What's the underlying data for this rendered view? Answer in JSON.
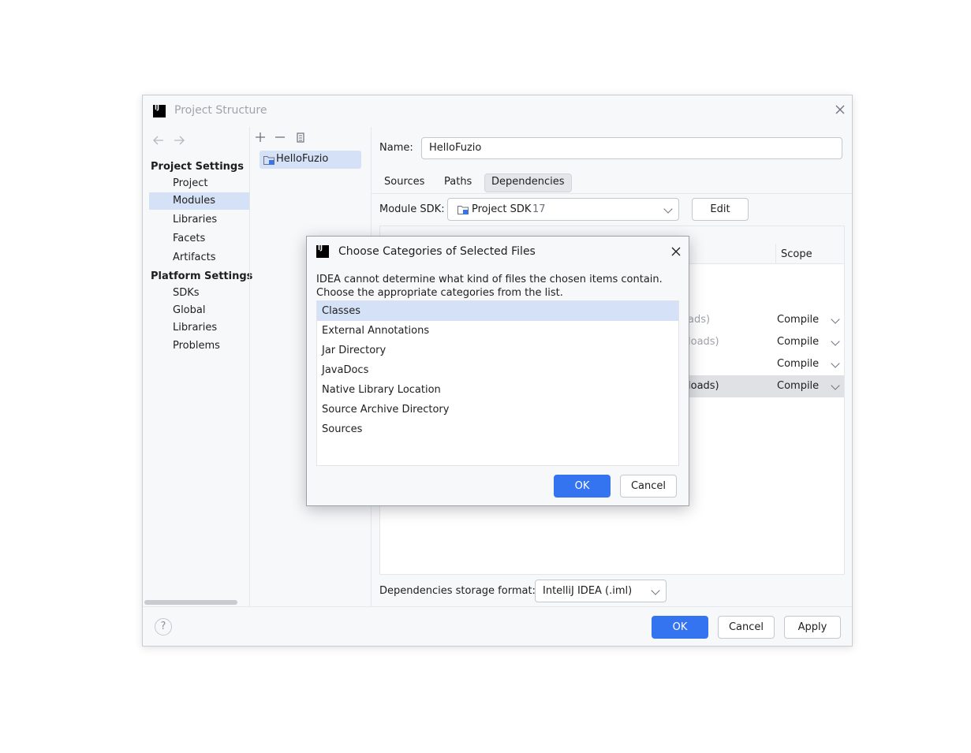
{
  "window": {
    "title": "Project Structure"
  },
  "sidebar": {
    "project_settings_header": "Project Settings",
    "project_items": [
      "Project",
      "Modules",
      "Libraries",
      "Facets",
      "Artifacts"
    ],
    "platform_settings_header": "Platform Settings",
    "platform_items": [
      "SDKs",
      "Global Libraries"
    ],
    "problems": "Problems"
  },
  "modules": {
    "items": [
      "HelloFuzio"
    ]
  },
  "module": {
    "name_label": "Name:",
    "name_value": "HelloFuzio",
    "tabs": [
      "Sources",
      "Paths",
      "Dependencies"
    ],
    "active_tab": "Dependencies",
    "sdk_label": "Module SDK:",
    "sdk_value": "Project SDK",
    "sdk_version": "17",
    "edit_label": "Edit",
    "table": {
      "scope_header": "Scope",
      "rows": [
        {
          "partial_name": "ads)",
          "scope": "Compile"
        },
        {
          "partial_name": "loads)",
          "scope": "Compile"
        },
        {
          "partial_name": "",
          "scope": "Compile"
        },
        {
          "partial_name": "loads)",
          "scope": "Compile"
        }
      ]
    },
    "storage_label": "Dependencies storage format:",
    "storage_value": "IntelliJ IDEA (.iml)"
  },
  "footer": {
    "ok": "OK",
    "cancel": "Cancel",
    "apply": "Apply"
  },
  "dialog": {
    "title": "Choose Categories of Selected Files",
    "message_line1": "IDEA cannot determine what kind of files the chosen items contain.",
    "message_line2": "Choose the appropriate categories from the list.",
    "categories": [
      "Classes",
      "External Annotations",
      "Jar Directory",
      "JavaDocs",
      "Native Library Location",
      "Source Archive Directory",
      "Sources"
    ],
    "selected_index": 0,
    "ok": "OK",
    "cancel": "Cancel"
  },
  "colors": {
    "accent": "#3574f0",
    "selection": "#d5e1f6"
  }
}
